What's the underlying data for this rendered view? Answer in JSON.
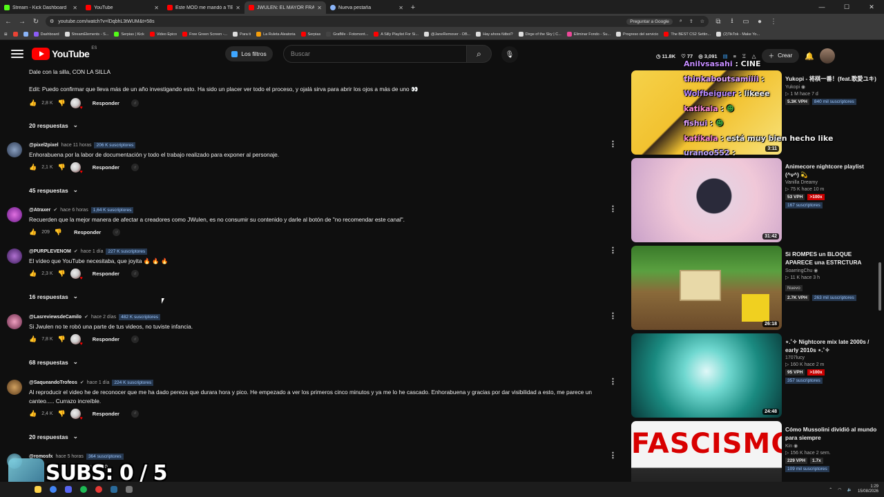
{
  "browser": {
    "tabs": [
      {
        "title": "Stream - Kick Dashboard",
        "color": "#53fc18",
        "active": false
      },
      {
        "title": "YouTube",
        "color": "#ff0000",
        "active": false
      },
      {
        "title": "Este MOD me mandó a TERAPIA",
        "color": "#ff0000",
        "active": false
      },
      {
        "title": "JWULEN: EL MAYOR FRAUDE DE",
        "color": "#ff0000",
        "active": true
      },
      {
        "title": "Nueva pestaña",
        "color": "#8ab4f8",
        "active": false
      }
    ],
    "url": "youtube.com/watch?v=lDqbhL3tWUM&t=58s",
    "ask_google": "Preguntar a Google",
    "bookmarks": [
      {
        "label": "Dashboard",
        "color": "#8b5cf6"
      },
      {
        "label": "StreamElements - S...",
        "color": "#ddd"
      },
      {
        "label": "Serpias | Kick",
        "color": "#53fc18"
      },
      {
        "label": "Video Epico",
        "color": "#ff0000"
      },
      {
        "label": "Free Green Screen -...",
        "color": "#ff0000"
      },
      {
        "label": "Para ti",
        "color": "#ddd"
      },
      {
        "label": "La Ruleta Aleatoria",
        "color": "#f59e0b"
      },
      {
        "label": "Serpias",
        "color": "#ff0000"
      },
      {
        "label": "GrafMe - Fotomont...",
        "color": "#444"
      },
      {
        "label": "A Silly Playlist For Si...",
        "color": "#ff0000"
      },
      {
        "label": "@JaneRemover - OB...",
        "color": "#ddd"
      },
      {
        "label": "Hay ahora fútbol?",
        "color": "#ddd"
      },
      {
        "label": "Dirge of the Sky | C...",
        "color": "#ddd"
      },
      {
        "label": "Eliminar Fondo - Su...",
        "color": "#ec4899"
      },
      {
        "label": "Progreso del servicio",
        "color": "#ddd"
      },
      {
        "label": "The BEST CS2 Settin...",
        "color": "#ff0000"
      },
      {
        "label": "(2)TikTok - Make Yo...",
        "color": "#ddd"
      }
    ]
  },
  "header": {
    "logo": "YouTube",
    "region": "ES",
    "filters": "Los filtros",
    "search_placeholder": "Buscar",
    "stats": [
      "11.8K",
      "77",
      "3,091"
    ],
    "create": "Crear"
  },
  "comments": [
    {
      "author": "",
      "time": "",
      "subs": "",
      "text": "Dale con la silla, CON LA SILLA\n\nEdit: Puedo confirmar que lleva más de un año investigando esto. Ha sido un placer ver todo el proceso, y ojalá sirva para abrir los ojos a más de uno 👀",
      "likes": "2,8 K",
      "reply": "Responder",
      "replies": "20 respuestas"
    },
    {
      "author": "@pixel2pixel",
      "time": "hace 11 horas",
      "subs": "206 K suscriptores",
      "text": "Enhorabuena por la labor de documentación y todo el trabajo realizado para exponer al personaje.",
      "likes": "2,1 K",
      "reply": "Responder",
      "replies": "45 respuestas"
    },
    {
      "author": "@Atraxer",
      "time": "hace 6 horas",
      "subs": "1,64 K suscriptores",
      "text": "Recuerden que la mejor manera de afectar a creadores como JWulen, es no consumir su contenido y darle al botón de \"no recomendar este canal\".",
      "likes": "209",
      "reply": "Responder",
      "replies": ""
    },
    {
      "author": "@PURPLEVENOM",
      "time": "hace 1 día",
      "subs": "227 K suscriptores",
      "text": "El vídeo que YouTube necesitaba, que joyita 🔥 🔥 🔥",
      "likes": "2,3 K",
      "reply": "Responder",
      "replies": "16 respuestas"
    },
    {
      "author": "@LasreviewsdeCamilo",
      "time": "hace 2 días",
      "subs": "482 K suscriptores",
      "text": "Si Jwulen no te robó una parte de tus videos, no tuviste infancia.",
      "likes": "7,8 K",
      "reply": "Responder",
      "replies": "68 respuestas"
    },
    {
      "author": "@SaqueandoTrofeos",
      "time": "hace 1 día",
      "subs": "224 K suscriptores",
      "text": "Al reproducir el video he de reconocer que me ha dado pereza que durara hora y pico. He empezado a ver los primeros cinco minutos y ya me lo he cascado. Enhorabuena y gracias por dar visibilidad a esto, me parece un canteo..... Currazo increíble.",
      "likes": "2,4 K",
      "reply": "Responder",
      "replies": "20 respuestas"
    },
    {
      "author": "@romosfx",
      "time": "hace 5 horas",
      "subs": "364 suscriptores",
      "text": "...ube ...ano",
      "likes": "",
      "reply": "",
      "replies": ""
    }
  ],
  "sidebar_videos": [
    {
      "title": "Yukopi - 将棋一番！(feat.歌愛ユキ)",
      "channel": "Yukopi",
      "meta": "1 M  hace 7 d",
      "vph": "5.3K VPH",
      "boost": "",
      "subs": "840 mil suscriptores",
      "duration": "3:11",
      "nuevo": ""
    },
    {
      "title": "Animecore nightcore playlist (^ν^) 💫",
      "channel": "Vanilla Dreamy",
      "meta": "75 K  hace 10 m",
      "vph": "53 VPH",
      "boost": ">100x",
      "subs": "167 suscriptores",
      "duration": "31:42",
      "nuevo": ""
    },
    {
      "title": "Si ROMPES un BLOQUE APARECE una ESTRCTURA",
      "channel": "SoarringChu",
      "meta": "11 K  hace 3 h",
      "vph": "2.7K VPH",
      "boost": "",
      "subs": "263 mil suscriptores",
      "duration": "26:18",
      "nuevo": "Nuevo"
    },
    {
      "title": "⋆.˚✧ Nightcore mix late 2000s / early 2010s ⋆.˚✧",
      "channel": "1707lucy",
      "meta": "160 K  hace 2 m",
      "vph": "95 VPH",
      "boost": ">100x",
      "subs": "357 suscriptores",
      "duration": "24:48",
      "nuevo": ""
    },
    {
      "title": "Cómo Mussolini dividió al mundo para siempre",
      "channel": "Kin",
      "meta": "156 K  hace 2 sem.",
      "vph": "229 VPH",
      "boost": "1.7x",
      "subs": "109 mil suscriptores",
      "duration": "",
      "nuevo": "",
      "thumb_text": "FASCISMO"
    }
  ],
  "chat_overlay": [
    {
      "name": "Anilvsasahi",
      "msg": ": CINE",
      "color": "#c58cff"
    },
    {
      "name": "thinkaboutsamiiii",
      "msg": ":",
      "color": "#e3a4ff"
    },
    {
      "name": "Wolfbeiguer",
      "msg": ": likeee",
      "color": "#b98aff"
    },
    {
      "name": "katikala",
      "msg": ":",
      "color": "#ff8ad8"
    },
    {
      "name": "fishui",
      "msg": ":",
      "color": "#e3a4ff"
    },
    {
      "name": "katikala",
      "msg": ": está muy bien hecho like",
      "color": "#ff8ad8"
    },
    {
      "name": "uranoo552",
      "msg": ":",
      "color": "#c0a8ff"
    }
  ],
  "overlay": {
    "subs_goal": "SUBS: 0 / 5"
  },
  "taskbar": {
    "time": "1:29",
    "date": "15/08/2026"
  }
}
